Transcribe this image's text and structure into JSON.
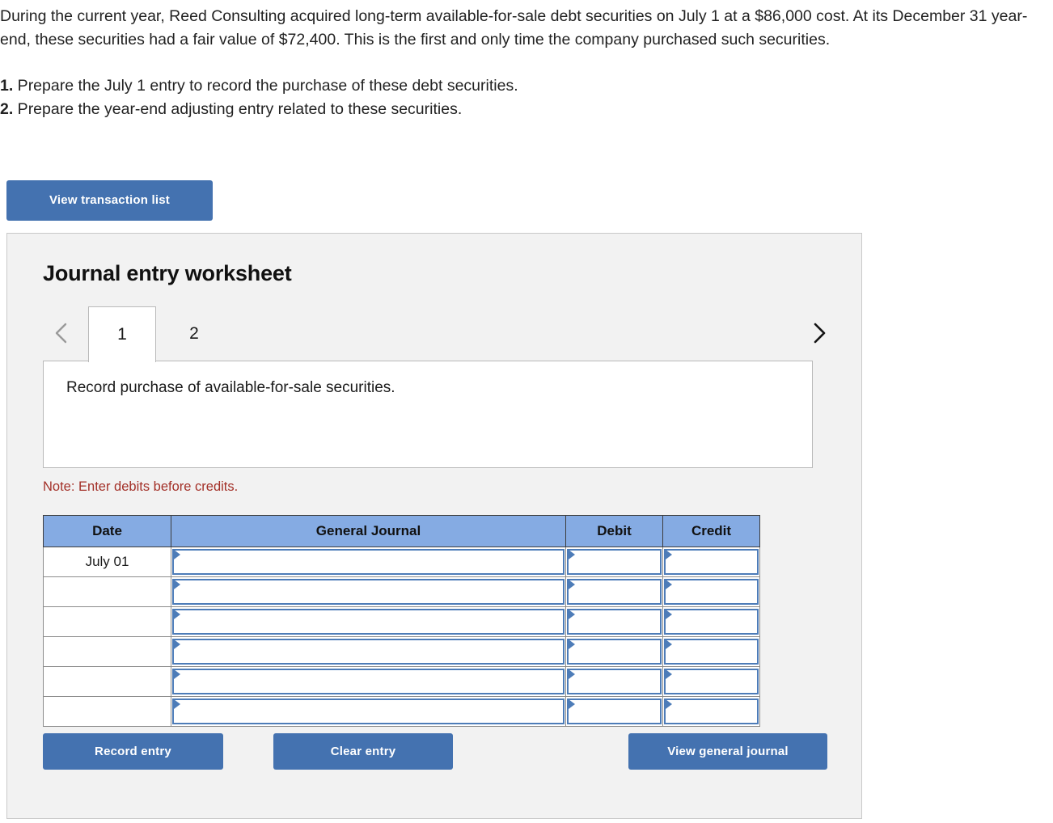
{
  "problem": {
    "paragraph": "During the current year, Reed Consulting acquired long-term available-for-sale debt securities on July 1 at a $86,000 cost. At its December 31 year-end, these securities had a fair value of $72,400. This is the first and only time the company purchased such securities.",
    "requirements": [
      {
        "number": "1.",
        "text": " Prepare the July 1 entry to record the purchase of these debt securities."
      },
      {
        "number": "2.",
        "text": " Prepare the year-end adjusting entry related to these securities."
      }
    ]
  },
  "toolbar": {
    "view_transaction_list_label": "View transaction list"
  },
  "worksheet": {
    "title": "Journal entry worksheet",
    "tabs": [
      {
        "label": "1",
        "active": true
      },
      {
        "label": "2",
        "active": false
      }
    ],
    "prev_icon": "chevron-left-icon",
    "next_icon": "chevron-right-icon",
    "description": "Record purchase of available-for-sale securities.",
    "note": "Note: Enter debits before credits.",
    "table": {
      "headers": [
        "Date",
        "General Journal",
        "Debit",
        "Credit"
      ],
      "rows": [
        {
          "date": "July 01",
          "general_journal": "",
          "debit": "",
          "credit": ""
        },
        {
          "date": "",
          "general_journal": "",
          "debit": "",
          "credit": ""
        },
        {
          "date": "",
          "general_journal": "",
          "debit": "",
          "credit": ""
        },
        {
          "date": "",
          "general_journal": "",
          "debit": "",
          "credit": ""
        },
        {
          "date": "",
          "general_journal": "",
          "debit": "",
          "credit": ""
        },
        {
          "date": "",
          "general_journal": "",
          "debit": "",
          "credit": ""
        }
      ]
    },
    "buttons": {
      "record_entry": "Record entry",
      "clear_entry": "Clear entry",
      "view_general_journal": "View general journal"
    }
  },
  "colors": {
    "button_blue": "#4472b0",
    "header_blue": "#85abe3",
    "cell_border_blue": "#4d7cb8",
    "note_red": "#a33028",
    "panel_bg": "#f2f2f2"
  }
}
